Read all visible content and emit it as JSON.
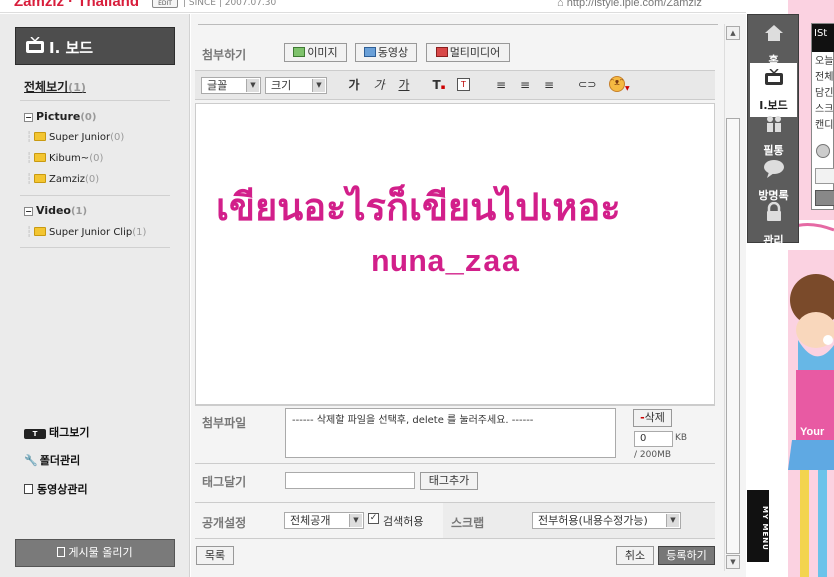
{
  "header": {
    "brand": "Zamziz · Thailand",
    "edit_badge": "EDIT",
    "since": "| SINCE | 2007.07.30",
    "url": "http://istyle.iple.com/Zamziz"
  },
  "sidebar": {
    "title": "I. 보드",
    "view_all": "전체보기",
    "view_all_count": "(1)",
    "categories": [
      {
        "name": "Picture",
        "count": "(0)",
        "items": [
          {
            "name": "Super Junior",
            "count": "(0)"
          },
          {
            "name": "Kibum~",
            "count": "(0)"
          },
          {
            "name": "Zamziz",
            "count": "(0)"
          }
        ]
      },
      {
        "name": "Video",
        "count": "(1)",
        "items": [
          {
            "name": "Super Junior Clip",
            "count": "(1)"
          }
        ]
      }
    ],
    "tools": [
      "태그보기",
      "폴더관리",
      "동영상관리"
    ],
    "upload_button": "게시물 올리기"
  },
  "editor": {
    "attach_label": "첨부하기",
    "attach_buttons": [
      "이미지",
      "동영상",
      "멀티미디어"
    ],
    "font_select": "글꼴",
    "size_select": "크기",
    "format_buttons": [
      "가",
      "가",
      "가"
    ],
    "content_line1": "เขียนอะไรก็เขียนไปเหอะ",
    "content_line2": "nuna_zaa",
    "file_label": "첨부파일",
    "file_hint": "------ 삭제할 파일을 선택후, delete 를 눌러주세요. ------",
    "delete_button": "삭제",
    "size_value": "0",
    "size_unit": "KB",
    "size_max": "/ 200MB",
    "tag_label": "태그달기",
    "tag_placeholder": "",
    "tag_add_button": "태그추가",
    "visibility_label": "공개설정",
    "visibility_value": "전체공개",
    "search_allow_label": "검색허용",
    "scrap_label": "스크랩",
    "scrap_value": "전부허용(내용수정가능)",
    "list_button": "목록",
    "cancel_button": "취소",
    "submit_button": "등록하기"
  },
  "right_nav": {
    "items": [
      "홈",
      "I.보드",
      "필통",
      "방명록",
      "관리"
    ],
    "active_index": 1,
    "my_menu": "MY MENU"
  },
  "right_panel": {
    "lines": [
      "ISt",
      "오늘",
      "전체",
      "담긴",
      "스크",
      "캔디"
    ]
  },
  "colors": {
    "brand": "#d81e3c",
    "content_text": "#d21f8a",
    "sidebar_header": "#4d4d4d",
    "right_nav": "#5c5c5c",
    "decoration_pink": "#fbd2e1"
  }
}
